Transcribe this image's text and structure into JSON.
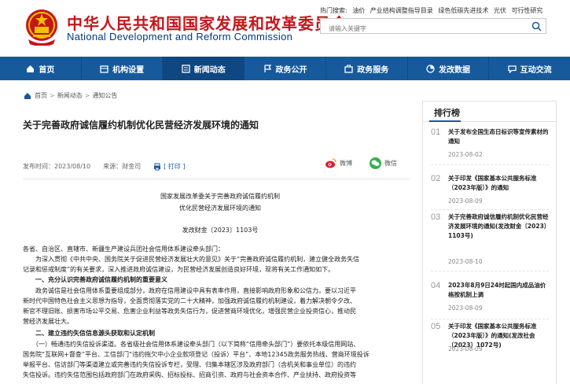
{
  "header": {
    "title_cn": "中华人民共和国国家发展和改革委员会",
    "title_en": "National Development and Reform Commission",
    "hot_label": "热门搜索:",
    "hot_terms": [
      "油价",
      "产业结构调整指导目录",
      "绿色低碳先进技术",
      "光伏",
      "可行性研究"
    ],
    "search_placeholder": "请输入关键字"
  },
  "nav": [
    {
      "label": "首页",
      "icon": "home-icon"
    },
    {
      "label": "机构设置",
      "icon": "org-icon"
    },
    {
      "label": "新闻动态",
      "icon": "news-icon",
      "active": true
    },
    {
      "label": "政务公开",
      "icon": "flag-icon"
    },
    {
      "label": "政务服务",
      "icon": "service-icon"
    },
    {
      "label": "发改数据",
      "icon": "data-icon"
    },
    {
      "label": "互动交流",
      "icon": "chat-icon"
    }
  ],
  "breadcrumb": {
    "items": [
      "首页",
      "新闻动态",
      "通知公告"
    ],
    "sep": ">"
  },
  "article": {
    "title": "关于完善政府诚信履约机制优化民营经济发展环境的通知",
    "date": "发布时间：2023/08/10",
    "source": "来源：财金司",
    "print": "[ 打印 ]",
    "share_weibo": "微博",
    "share_wechat": "微信",
    "doc_title_1": "国家发展改革委关于完善政府诚信履约机制",
    "doc_title_2": "优化民营经济发展环境的通知",
    "doc_number": "发改财金〔2023〕1103号",
    "lines": [
      "各省、自治区、直辖市、新疆生产建设兵团社会信用体系建设牵头部门：",
      "　　为深入贯彻《中共中央、国务院关于促进民营经济发展壮大的意见》关于“完善政府诚信履约机制，建立健全政务失信",
      "记录和惩戒制度”的有关要求，深入推进政府诚信建设，为民营经济发展创造良好环境，现将有关工作通知如下。",
      "　　一、充分认识完善政府诚信履约机制的重要意义",
      "　　政务诚信是社会信用体系重要组成部分，政府在信用建设中具有表率作用，直接影响政府形象和公信力。要以习近平",
      "新时代中国特色社会主义思想为指导，全面贯彻落实党的二十大精神，加强政府诚信履约机制建设，着力解决朝令夕改、",
      "新官不理旧账、损害市场公平交易、危害企业利益等政务失信行为，促进营商环境优化，增强民营企业投资信心，推动民",
      "营经济发展壮大。",
      "　　二、建立违约失信信息源头获取和认定机制",
      "　　（一）畅通违约失信投诉渠道。各省级社会信用体系建设牵头部门（以下简称“信用牵头部门”）要依托本级信用网站、",
      "国务院“互联网+督查”平台、工信部门“违约拖欠中小企业款项登记（投诉）平台”、本地12345政务服务热线、营商环境投诉",
      "举报平台、信访部门等渠道建立或完善违约失信投诉专栏，受理、归集本辖区涉及政府部门（含机关和事业单位）的违约",
      "失信投诉。违约失信范围包括政府部门在政府采购、招标投标、招商引资、政府与社会资本合作、产业扶持、政府投资等"
    ]
  },
  "sidebar": {
    "title": "排行榜",
    "items": [
      {
        "num": "01",
        "text": "关于发布全国生态日标识等宣传素材的通知",
        "date": "2023-08-02"
      },
      {
        "num": "02",
        "text": "关于印发《国家基本公共服务标准（2023年版）》的通知",
        "date": "2023-08-09"
      },
      {
        "num": "03",
        "text": "关于完善政府诚信履约机制优化民营经济发展环境的通知(发改财金〔2023〕1103号)",
        "date": "2023-08-10"
      },
      {
        "num": "04",
        "text": "2023年8月9日24时起国内成品油价格按机制上调",
        "date": "2023-08-09"
      },
      {
        "num": "05",
        "text": "关于印发《国家基本公共服务标准（2023年版）》的通知(发改社会〔2023〕1072号)",
        "date": "2023-08-09"
      }
    ]
  },
  "colors": {
    "brand_red": "#c4161c",
    "nav_blue": "#175a9c",
    "nav_active": "#0e4781"
  }
}
